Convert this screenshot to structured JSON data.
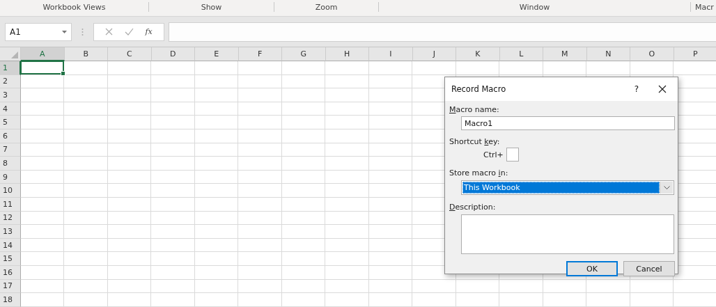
{
  "ribbon_groups": [
    {
      "label": "Workbook Views"
    },
    {
      "label": "Show"
    },
    {
      "label": "Zoom"
    },
    {
      "label": "Window"
    },
    {
      "label": "Macr"
    }
  ],
  "formula_bar": {
    "name_box": "A1",
    "function_label": "fx"
  },
  "columns": [
    {
      "label": "A",
      "selected": true
    },
    {
      "label": "B",
      "selected": false
    },
    {
      "label": "C",
      "selected": false
    },
    {
      "label": "D",
      "selected": false
    },
    {
      "label": "E",
      "selected": false
    },
    {
      "label": "F",
      "selected": false
    },
    {
      "label": "G",
      "selected": false
    },
    {
      "label": "H",
      "selected": false
    },
    {
      "label": "I",
      "selected": false
    },
    {
      "label": "J",
      "selected": false
    },
    {
      "label": "K",
      "selected": false
    },
    {
      "label": "L",
      "selected": false
    },
    {
      "label": "M",
      "selected": false
    },
    {
      "label": "N",
      "selected": false
    },
    {
      "label": "O",
      "selected": false
    },
    {
      "label": "P",
      "selected": false
    }
  ],
  "rows": [
    {
      "label": "1",
      "selected": true
    },
    {
      "label": "2",
      "selected": false
    },
    {
      "label": "3",
      "selected": false
    },
    {
      "label": "4",
      "selected": false
    },
    {
      "label": "5",
      "selected": false
    },
    {
      "label": "6",
      "selected": false
    },
    {
      "label": "7",
      "selected": false
    },
    {
      "label": "8",
      "selected": false
    },
    {
      "label": "9",
      "selected": false
    },
    {
      "label": "10",
      "selected": false
    },
    {
      "label": "11",
      "selected": false
    },
    {
      "label": "12",
      "selected": false
    },
    {
      "label": "13",
      "selected": false
    },
    {
      "label": "14",
      "selected": false
    },
    {
      "label": "15",
      "selected": false
    },
    {
      "label": "16",
      "selected": false
    },
    {
      "label": "17",
      "selected": false
    },
    {
      "label": "18",
      "selected": false
    }
  ],
  "dialog": {
    "title": "Record Macro",
    "help": "?",
    "macro_name": {
      "label": {
        "key": "M",
        "after": "acro name:"
      },
      "value": "Macro1"
    },
    "shortcut": {
      "label": {
        "before": "Shortcut ",
        "key": "k",
        "after": "ey:"
      },
      "prefix": "Ctrl+"
    },
    "store": {
      "label": {
        "before": "Store macro ",
        "key": "i",
        "after": "n:"
      },
      "value": "This Workbook",
      "selected": true
    },
    "description": {
      "label": {
        "key": "D",
        "after": "escription:"
      }
    },
    "buttons": [
      {
        "label": "OK",
        "kind": "default"
      },
      {
        "label": "Cancel",
        "kind": "normal"
      }
    ]
  }
}
